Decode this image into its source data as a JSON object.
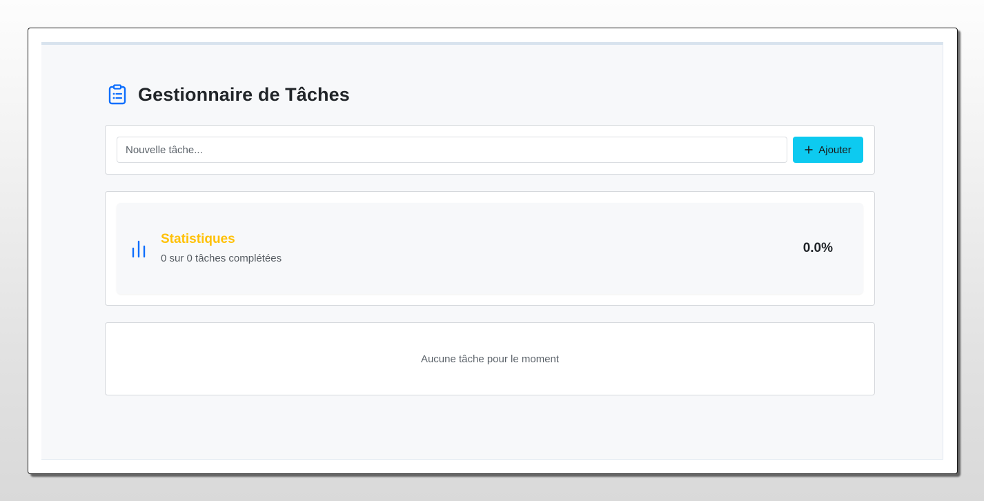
{
  "header": {
    "title": "Gestionnaire de Tâches",
    "icon": "clipboard-list-icon"
  },
  "add_form": {
    "input_placeholder": "Nouvelle tâche...",
    "input_value": "",
    "button_label": "Ajouter",
    "button_icon": "plus-icon"
  },
  "stats": {
    "icon": "bar-chart-icon",
    "title": "Statistiques",
    "summary": "0 sur 0 tâches complétées",
    "completed": 0,
    "total": 0,
    "percent_label": "0.0%"
  },
  "tasks": {
    "empty_message": "Aucune tâche pour le moment",
    "items": []
  },
  "colors": {
    "accent_blue": "#0d6efd",
    "button_cyan": "#0dcaf0",
    "stats_title_yellow": "#ffc107",
    "app_background": "#f7f8fa"
  }
}
